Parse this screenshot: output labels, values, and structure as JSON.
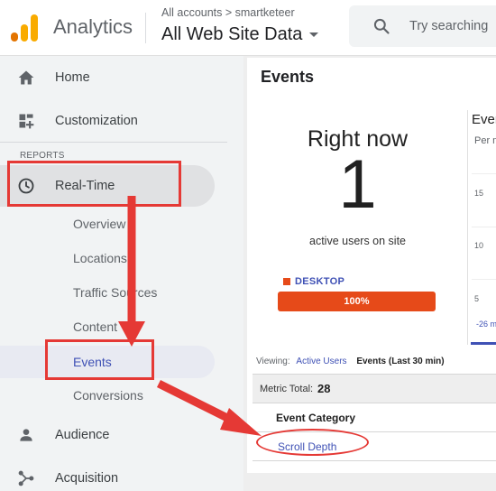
{
  "header": {
    "app_name": "Analytics",
    "account_path": "All accounts > smartketeer",
    "property_name": "All Web Site Data",
    "search_placeholder": "Try searching"
  },
  "sidebar": {
    "section_label": "REPORTS",
    "items": [
      {
        "label": "Home",
        "icon": "home-icon"
      },
      {
        "label": "Customization",
        "icon": "dashboard-icon"
      },
      {
        "label": "Real-Time",
        "icon": "clock-icon"
      },
      {
        "label": "Audience",
        "icon": "person-icon"
      },
      {
        "label": "Acquisition",
        "icon": "acquisition-icon"
      }
    ],
    "realtime_subitems": [
      "Overview",
      "Locations",
      "Traffic Sources",
      "Content",
      "Events",
      "Conversions"
    ],
    "active_subitem": "Events"
  },
  "main": {
    "title": "Events",
    "right_now_label": "Right now",
    "active_users_count": "1",
    "active_users_label": "active users on site",
    "device": {
      "label": "DESKTOP",
      "percent_label": "100%",
      "share": 1.0,
      "color": "#e64a19"
    },
    "mini_chart": {
      "title": "Even",
      "subtitle": "Per m",
      "y_ticks": [
        "15",
        "10",
        "5"
      ],
      "x_label": "-26 m"
    },
    "viewing": {
      "prefix": "Viewing:",
      "active_users_link": "Active Users",
      "events_label": "Events",
      "events_range": "(Last 30 min)"
    },
    "metric_total_label": "Metric Total:",
    "metric_total_value": "28",
    "column_header": "Event Category",
    "rows": [
      "Scroll Depth"
    ]
  },
  "colors": {
    "annotation": "#e53935",
    "accent": "#3f51b5",
    "logo_orange": "#f9ab00",
    "logo_dark_orange": "#e37400"
  }
}
